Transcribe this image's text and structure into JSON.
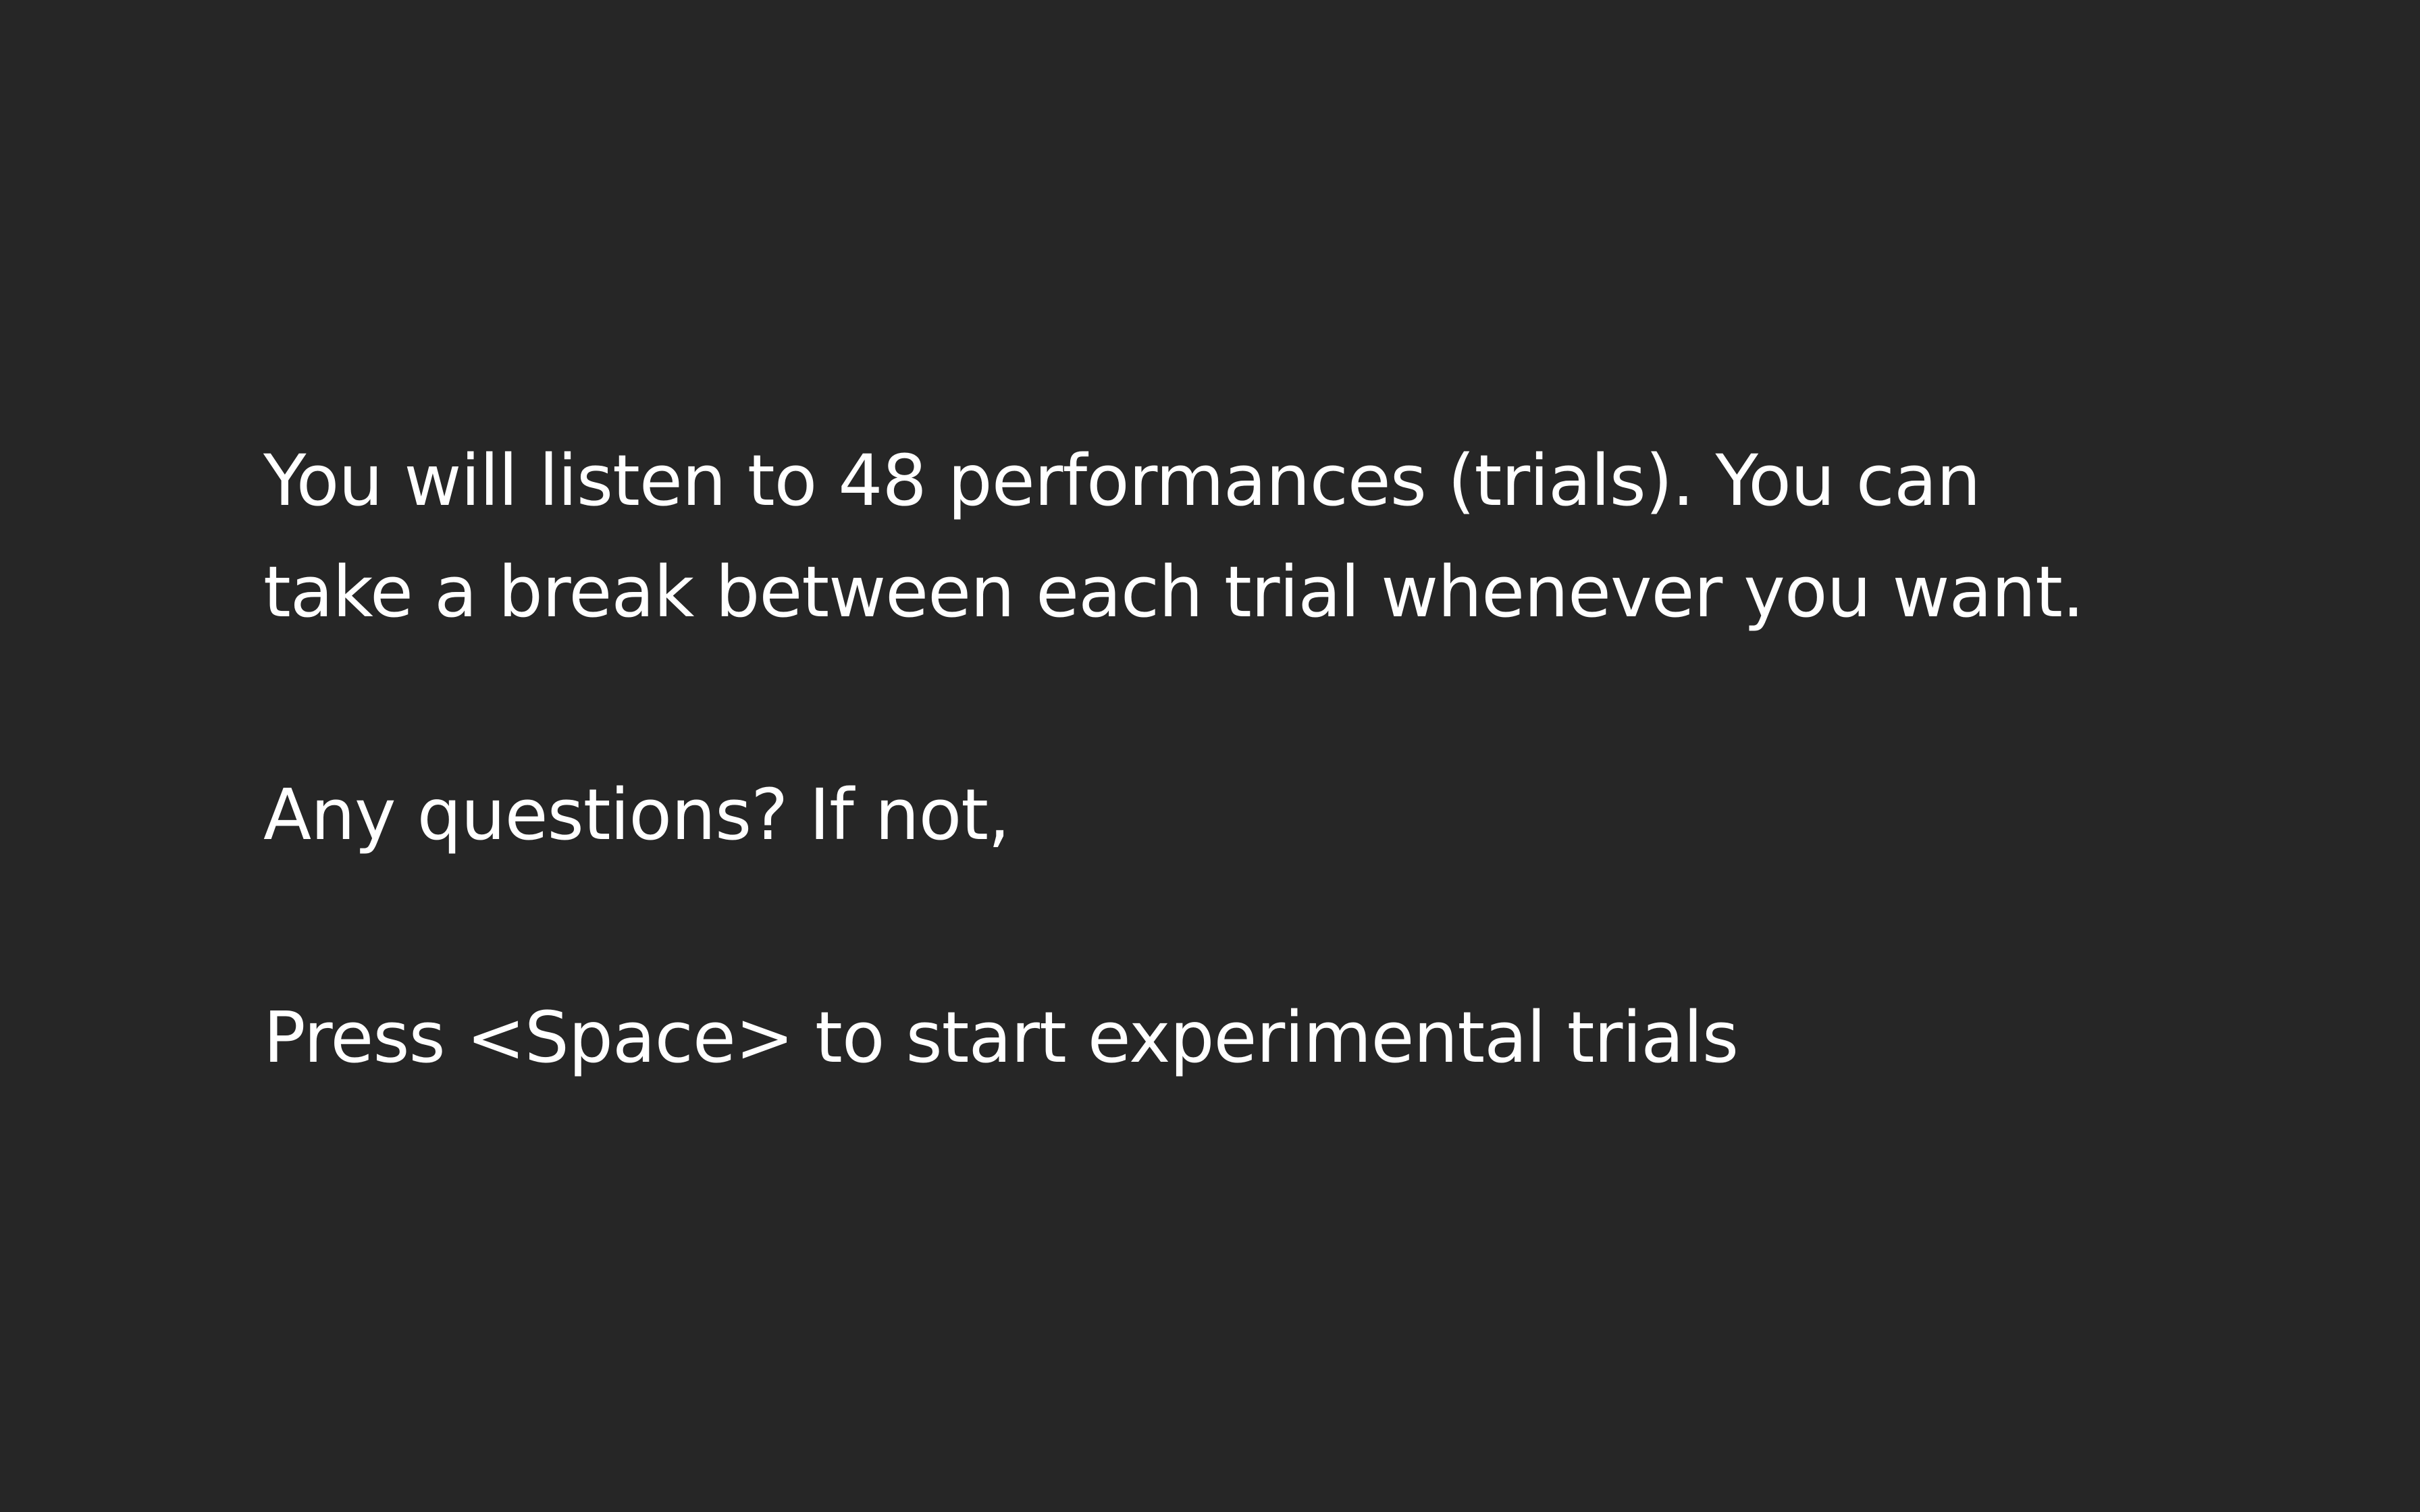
{
  "instructions": {
    "line1": "You will listen to 48 performances (trials). You can",
    "line2": "take a break between each trial whenever you want.",
    "line3": "Any questions? If not,",
    "line4": "Press <Space> to start experimental trials"
  },
  "colors": {
    "background": "#262626",
    "text": "#ffffff"
  }
}
